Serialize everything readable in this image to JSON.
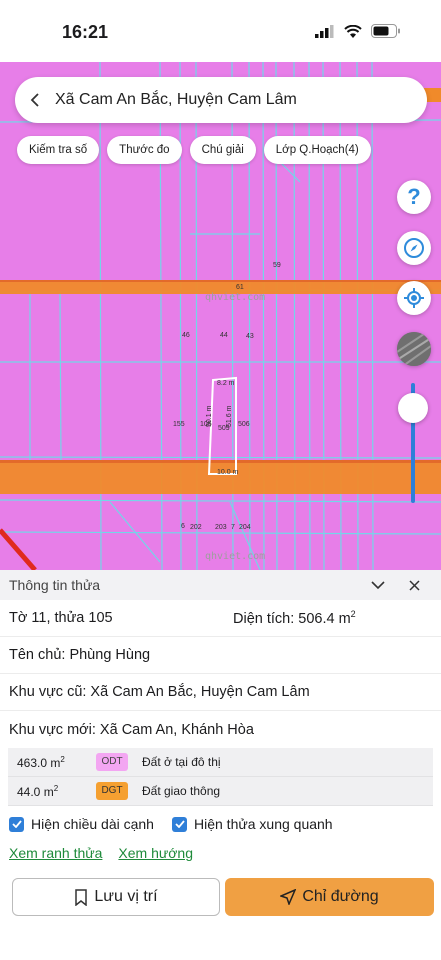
{
  "status": {
    "time": "16:21"
  },
  "search": {
    "title": "Xã Cam An Bắc, Huyện Cam Lâm"
  },
  "chips": [
    "Kiếm tra số",
    "Thước đo",
    "Chú giải",
    "Lớp Q.Hoạch(4)"
  ],
  "map": {
    "watermark": "qhviet.com",
    "labels": {
      "road_61": "61",
      "p59": "59",
      "p46": "46",
      "p44": "44",
      "p43": "43",
      "p155": "155",
      "p105": "105",
      "p506": "506",
      "p509": "509",
      "p6": "6",
      "p202": "202",
      "p203": "203",
      "p7": "7",
      "p204": "204"
    },
    "dims": {
      "top": "8.2 m",
      "left": "50.1 m",
      "right": "51.6 m",
      "bottom": "10.0 m"
    },
    "colors": {
      "residential": "#e77ee8",
      "road": "#f08a2a",
      "grid": "#73d6e8"
    }
  },
  "panel": {
    "header": "Thông tin thửa",
    "parcel": "Tờ 11, thửa 105",
    "area_label": "Diện tích: 506.4 m",
    "area_sup": "2",
    "owner": "Tên chủ: Phùng Hùng",
    "old_area": "Khu vực cũ: Xã Cam An Bắc, Huyện Cam Lâm",
    "new_area": "Khu vực mới: Xã Cam An, Khánh Hòa",
    "land_rows": [
      {
        "area": "463.0 m",
        "sup": "2",
        "code": "ODT",
        "desc": "Đất ở tại đô thị"
      },
      {
        "area": "44.0 m",
        "sup": "2",
        "code": "DGT",
        "desc": "Đất giao thông"
      }
    ],
    "check1": "Hiện chiều dài cạnh",
    "check2": "Hiện thửa xung quanh",
    "link1": "Xem ranh thửa",
    "link2": "Xem hướng",
    "save_label": "Lưu vị trí",
    "route_label": "Chỉ đường"
  }
}
